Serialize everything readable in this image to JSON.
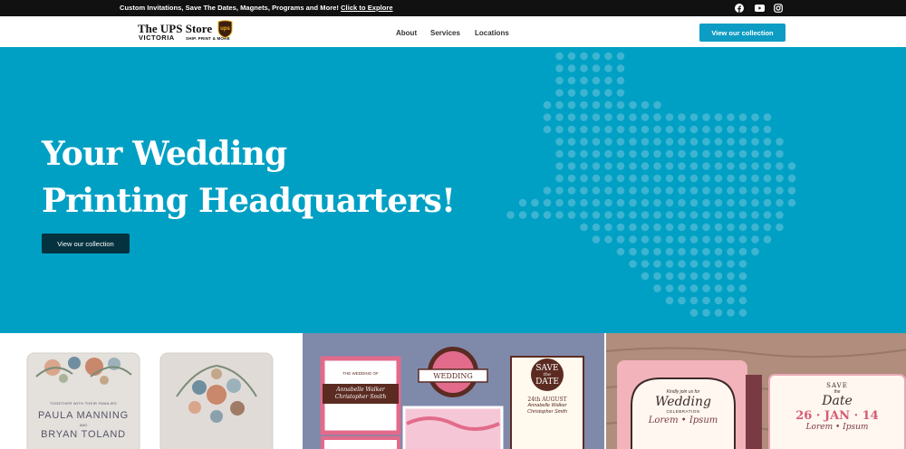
{
  "announcement": {
    "text": "Custom Invitations, Save The Dates, Magnets, Programs and More!",
    "link": "Click to Explore"
  },
  "social": [
    "facebook-icon",
    "youtube-icon",
    "instagram-icon"
  ],
  "logo": {
    "line1": "The UPS Store",
    "line2": "VICTORIA",
    "tagline": "SHIP. PRINT & MORE",
    "shield_text": "ups"
  },
  "nav": {
    "items": [
      "About",
      "Services",
      "Locations"
    ],
    "header_button": "View our collection"
  },
  "hero": {
    "title_line1": "Your Wedding",
    "title_line2": "Printing Headquarters!",
    "cta": "View our collection"
  },
  "gallery": {
    "card1": {
      "small": "TOGETHER WITH THEIR FAMILIES",
      "name1": "PAULA MANNING",
      "and": "AND",
      "name2": "BRYAN TOLAND"
    },
    "card2": {
      "the_wedding_of": "THE WEDDING OF",
      "name1": "Annabelle Walker",
      "name2": "Christopher Smith",
      "circle": "WEDDING",
      "save_the": "SAVE",
      "the": "the",
      "date": "DATE",
      "date_text": "24th AUGUST",
      "couple": "Annabelle Walker",
      "couple2": "Christopher Smith"
    },
    "card3": {
      "invite_line": "Kindly join us for",
      "wedding": "Wedding",
      "celebration": "CELEBRATION",
      "save": "SAVE",
      "the": "the",
      "date_word": "Date",
      "date": "26 · JAN · 14",
      "names": "Lorem • Ipsum"
    }
  },
  "colors": {
    "accent": "#0d9cc3",
    "hero_bg": "#00a0c4",
    "cta_bg": "#05323f",
    "topbar": "#111111"
  }
}
